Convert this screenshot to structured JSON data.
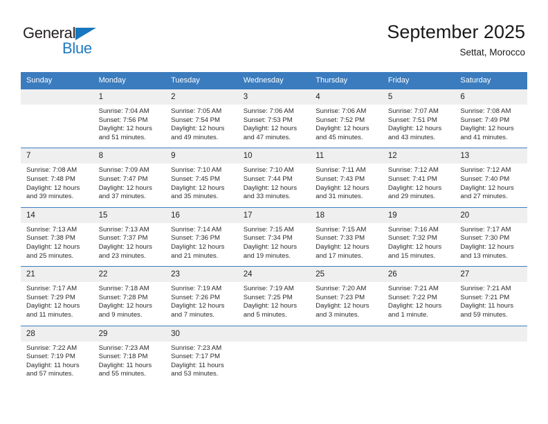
{
  "brand": {
    "name_part1": "General",
    "name_part2": "Blue",
    "triangle_color": "#1877bf",
    "blue_color": "#1f7ac2"
  },
  "header": {
    "title": "September 2025",
    "subtitle": "Settat, Morocco"
  },
  "theme": {
    "header_bg": "#3a7cbe",
    "header_text": "#ffffff",
    "daynum_bg": "#efefef",
    "row_border": "#3a7cbe"
  },
  "weekdays": [
    "Sunday",
    "Monday",
    "Tuesday",
    "Wednesday",
    "Thursday",
    "Friday",
    "Saturday"
  ],
  "weeks": [
    [
      {
        "day": "",
        "lines": []
      },
      {
        "day": "1",
        "lines": [
          "Sunrise: 7:04 AM",
          "Sunset: 7:56 PM",
          "Daylight: 12 hours",
          "and 51 minutes."
        ]
      },
      {
        "day": "2",
        "lines": [
          "Sunrise: 7:05 AM",
          "Sunset: 7:54 PM",
          "Daylight: 12 hours",
          "and 49 minutes."
        ]
      },
      {
        "day": "3",
        "lines": [
          "Sunrise: 7:06 AM",
          "Sunset: 7:53 PM",
          "Daylight: 12 hours",
          "and 47 minutes."
        ]
      },
      {
        "day": "4",
        "lines": [
          "Sunrise: 7:06 AM",
          "Sunset: 7:52 PM",
          "Daylight: 12 hours",
          "and 45 minutes."
        ]
      },
      {
        "day": "5",
        "lines": [
          "Sunrise: 7:07 AM",
          "Sunset: 7:51 PM",
          "Daylight: 12 hours",
          "and 43 minutes."
        ]
      },
      {
        "day": "6",
        "lines": [
          "Sunrise: 7:08 AM",
          "Sunset: 7:49 PM",
          "Daylight: 12 hours",
          "and 41 minutes."
        ]
      }
    ],
    [
      {
        "day": "7",
        "lines": [
          "Sunrise: 7:08 AM",
          "Sunset: 7:48 PM",
          "Daylight: 12 hours",
          "and 39 minutes."
        ]
      },
      {
        "day": "8",
        "lines": [
          "Sunrise: 7:09 AM",
          "Sunset: 7:47 PM",
          "Daylight: 12 hours",
          "and 37 minutes."
        ]
      },
      {
        "day": "9",
        "lines": [
          "Sunrise: 7:10 AM",
          "Sunset: 7:45 PM",
          "Daylight: 12 hours",
          "and 35 minutes."
        ]
      },
      {
        "day": "10",
        "lines": [
          "Sunrise: 7:10 AM",
          "Sunset: 7:44 PM",
          "Daylight: 12 hours",
          "and 33 minutes."
        ]
      },
      {
        "day": "11",
        "lines": [
          "Sunrise: 7:11 AM",
          "Sunset: 7:43 PM",
          "Daylight: 12 hours",
          "and 31 minutes."
        ]
      },
      {
        "day": "12",
        "lines": [
          "Sunrise: 7:12 AM",
          "Sunset: 7:41 PM",
          "Daylight: 12 hours",
          "and 29 minutes."
        ]
      },
      {
        "day": "13",
        "lines": [
          "Sunrise: 7:12 AM",
          "Sunset: 7:40 PM",
          "Daylight: 12 hours",
          "and 27 minutes."
        ]
      }
    ],
    [
      {
        "day": "14",
        "lines": [
          "Sunrise: 7:13 AM",
          "Sunset: 7:38 PM",
          "Daylight: 12 hours",
          "and 25 minutes."
        ]
      },
      {
        "day": "15",
        "lines": [
          "Sunrise: 7:13 AM",
          "Sunset: 7:37 PM",
          "Daylight: 12 hours",
          "and 23 minutes."
        ]
      },
      {
        "day": "16",
        "lines": [
          "Sunrise: 7:14 AM",
          "Sunset: 7:36 PM",
          "Daylight: 12 hours",
          "and 21 minutes."
        ]
      },
      {
        "day": "17",
        "lines": [
          "Sunrise: 7:15 AM",
          "Sunset: 7:34 PM",
          "Daylight: 12 hours",
          "and 19 minutes."
        ]
      },
      {
        "day": "18",
        "lines": [
          "Sunrise: 7:15 AM",
          "Sunset: 7:33 PM",
          "Daylight: 12 hours",
          "and 17 minutes."
        ]
      },
      {
        "day": "19",
        "lines": [
          "Sunrise: 7:16 AM",
          "Sunset: 7:32 PM",
          "Daylight: 12 hours",
          "and 15 minutes."
        ]
      },
      {
        "day": "20",
        "lines": [
          "Sunrise: 7:17 AM",
          "Sunset: 7:30 PM",
          "Daylight: 12 hours",
          "and 13 minutes."
        ]
      }
    ],
    [
      {
        "day": "21",
        "lines": [
          "Sunrise: 7:17 AM",
          "Sunset: 7:29 PM",
          "Daylight: 12 hours",
          "and 11 minutes."
        ]
      },
      {
        "day": "22",
        "lines": [
          "Sunrise: 7:18 AM",
          "Sunset: 7:28 PM",
          "Daylight: 12 hours",
          "and 9 minutes."
        ]
      },
      {
        "day": "23",
        "lines": [
          "Sunrise: 7:19 AM",
          "Sunset: 7:26 PM",
          "Daylight: 12 hours",
          "and 7 minutes."
        ]
      },
      {
        "day": "24",
        "lines": [
          "Sunrise: 7:19 AM",
          "Sunset: 7:25 PM",
          "Daylight: 12 hours",
          "and 5 minutes."
        ]
      },
      {
        "day": "25",
        "lines": [
          "Sunrise: 7:20 AM",
          "Sunset: 7:23 PM",
          "Daylight: 12 hours",
          "and 3 minutes."
        ]
      },
      {
        "day": "26",
        "lines": [
          "Sunrise: 7:21 AM",
          "Sunset: 7:22 PM",
          "Daylight: 12 hours",
          "and 1 minute."
        ]
      },
      {
        "day": "27",
        "lines": [
          "Sunrise: 7:21 AM",
          "Sunset: 7:21 PM",
          "Daylight: 11 hours",
          "and 59 minutes."
        ]
      }
    ],
    [
      {
        "day": "28",
        "lines": [
          "Sunrise: 7:22 AM",
          "Sunset: 7:19 PM",
          "Daylight: 11 hours",
          "and 57 minutes."
        ]
      },
      {
        "day": "29",
        "lines": [
          "Sunrise: 7:23 AM",
          "Sunset: 7:18 PM",
          "Daylight: 11 hours",
          "and 55 minutes."
        ]
      },
      {
        "day": "30",
        "lines": [
          "Sunrise: 7:23 AM",
          "Sunset: 7:17 PM",
          "Daylight: 11 hours",
          "and 53 minutes."
        ]
      },
      {
        "day": "",
        "lines": []
      },
      {
        "day": "",
        "lines": []
      },
      {
        "day": "",
        "lines": []
      },
      {
        "day": "",
        "lines": []
      }
    ]
  ]
}
